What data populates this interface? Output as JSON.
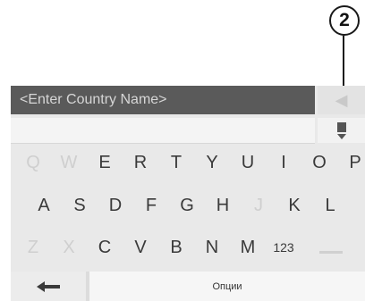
{
  "callout": {
    "number": "2"
  },
  "search": {
    "placeholder": "<Enter Country Name>"
  },
  "keyboard": {
    "rows": [
      [
        "Q",
        "W",
        "E",
        "R",
        "T",
        "Y",
        "U",
        "I",
        "O",
        "P"
      ],
      [
        "A",
        "S",
        "D",
        "F",
        "G",
        "H",
        "J",
        "K",
        "L"
      ],
      [
        "Z",
        "X",
        "C",
        "V",
        "B",
        "N",
        "M",
        "123",
        ""
      ]
    ],
    "dimmed_keys": [
      "Q",
      "W",
      "J",
      "Z",
      "X"
    ],
    "options_label": "Опции"
  },
  "icons": {
    "back": "back-arrow-icon",
    "list": "list-toggle-icon",
    "delete": "left-arrow-icon"
  },
  "colors": {
    "input_background": "#5a5a5a",
    "screen_background": "#e9e9e9",
    "key_text": "#3a3a3a",
    "dim_key_text": "#cfcfcf"
  }
}
